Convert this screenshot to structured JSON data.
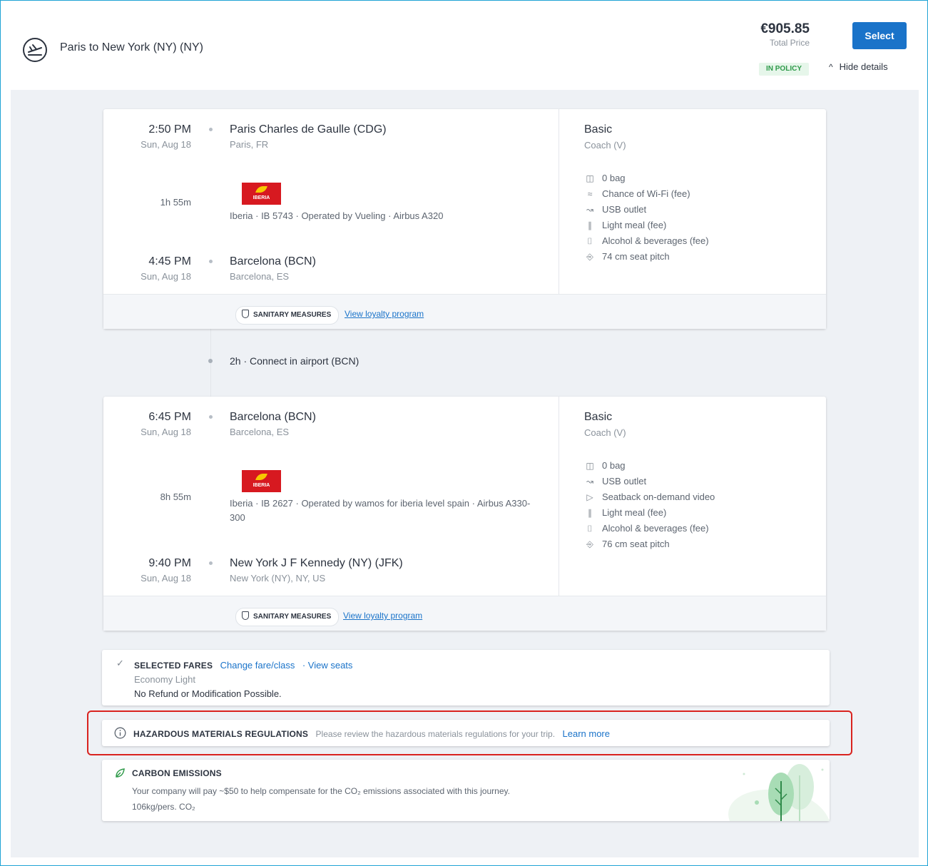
{
  "header": {
    "route_title": "Paris to New York (NY) (NY)",
    "price": "€905.85",
    "price_label": "Total Price",
    "select_label": "Select",
    "policy_badge": "IN POLICY",
    "hide_details_label": "Hide details"
  },
  "segments": [
    {
      "depart_time": "2:50 PM",
      "depart_date": "Sun, Aug 18",
      "depart_airport": "Paris Charles de Gaulle (CDG)",
      "depart_city": "Paris, FR",
      "duration": "1h 55m",
      "airline_logo_text": "IBERIA",
      "flight_info": "Iberia · IB 5743 · Operated by Vueling · Airbus A320",
      "arrive_time": "4:45 PM",
      "arrive_date": "Sun, Aug 18",
      "arrive_airport": "Barcelona (BCN)",
      "arrive_city": "Barcelona, ES",
      "fare_title": "Basic",
      "fare_class": "Coach (V)",
      "amenities": [
        {
          "icon": "bag-icon",
          "label": "0 bag"
        },
        {
          "icon": "wifi-icon",
          "label": "Chance of Wi-Fi (fee)"
        },
        {
          "icon": "usb-plug-icon",
          "label": "USB outlet"
        },
        {
          "icon": "fork-knife-icon",
          "label": "Light meal (fee)"
        },
        {
          "icon": "drinks-icon",
          "label": "Alcohol & beverages (fee)"
        },
        {
          "icon": "seat-icon",
          "label": "74 cm seat pitch"
        }
      ],
      "sanitary_label": "SANITARY MEASURES",
      "loyalty_label": "View loyalty program"
    },
    {
      "depart_time": "6:45 PM",
      "depart_date": "Sun, Aug 18",
      "depart_airport": "Barcelona (BCN)",
      "depart_city": "Barcelona, ES",
      "duration": "8h 55m",
      "airline_logo_text": "IBERIA",
      "flight_info": "Iberia · IB 2627 · Operated by wamos for iberia level spain · Airbus A330-300",
      "arrive_time": "9:40 PM",
      "arrive_date": "Sun, Aug 18",
      "arrive_airport": "New York J F Kennedy (NY) (JFK)",
      "arrive_city": "New York (NY), NY, US",
      "fare_title": "Basic",
      "fare_class": "Coach (V)",
      "amenities": [
        {
          "icon": "bag-icon",
          "label": "0 bag"
        },
        {
          "icon": "usb-plug-icon",
          "label": "USB outlet"
        },
        {
          "icon": "video-icon",
          "label": "Seatback on-demand video"
        },
        {
          "icon": "fork-knife-icon",
          "label": "Light meal (fee)"
        },
        {
          "icon": "drinks-icon",
          "label": "Alcohol & beverages (fee)"
        },
        {
          "icon": "seat-icon",
          "label": "76 cm seat pitch"
        }
      ],
      "sanitary_label": "SANITARY MEASURES",
      "loyalty_label": "View loyalty program"
    }
  ],
  "connection": {
    "text": "2h · Connect in airport (BCN)"
  },
  "fares": {
    "title": "SELECTED FARES",
    "change_link": "Change fare/class",
    "seats_link": "· View seats",
    "fare_name": "Economy Light",
    "conditions": "No Refund or Modification Possible."
  },
  "hazmat": {
    "title": "HAZARDOUS MATERIALS REGULATIONS",
    "text": "Please review the hazardous materials regulations for your trip.",
    "link": "Learn more"
  },
  "carbon": {
    "title": "CARBON EMISSIONS",
    "text": "Your company will pay ~$50 to help compensate for the CO₂ emissions associated with this journey.",
    "amount": "106kg/pers. CO₂"
  },
  "colors": {
    "accent": "#1a73c9",
    "policy_green": "#2f9a4a",
    "highlight_red": "#d9231f",
    "iberia_red": "#d71920"
  }
}
